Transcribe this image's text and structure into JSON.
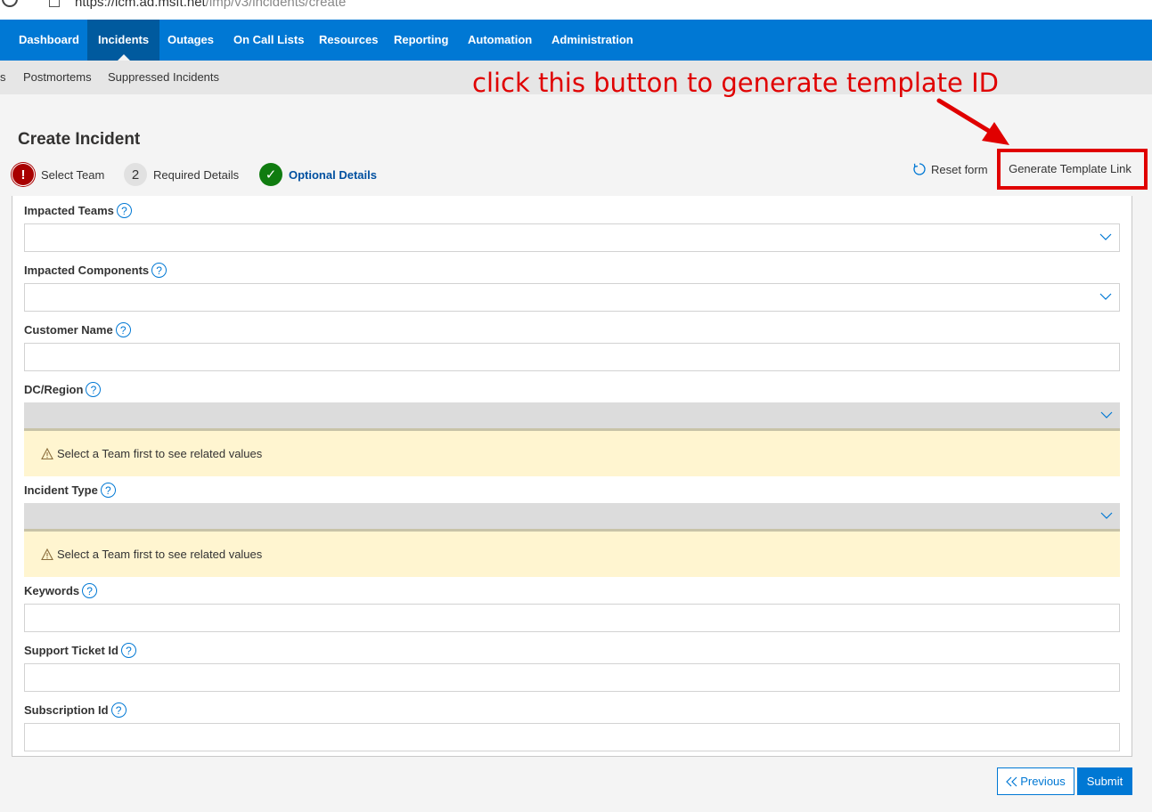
{
  "browser": {
    "url_host": "https://icm.ad.msft.net",
    "url_path": "/imp/v3/incidents/create"
  },
  "topnav": {
    "items": [
      {
        "label": "Dashboard"
      },
      {
        "label": "Incidents",
        "active": true
      },
      {
        "label": "Outages"
      },
      {
        "label": "On Call Lists"
      },
      {
        "label": "Resources"
      },
      {
        "label": "Reporting"
      },
      {
        "label": "Automation"
      },
      {
        "label": "Administration"
      }
    ]
  },
  "subnav": {
    "partial": "s",
    "items": [
      {
        "label": "Postmortems"
      },
      {
        "label": "Suppressed Incidents"
      }
    ]
  },
  "annotation": {
    "text": "click this button to generate template ID",
    "color": "#e00000"
  },
  "page": {
    "title": "Create Incident"
  },
  "steps": [
    {
      "marker": "!",
      "label": "Select Team",
      "state": "error"
    },
    {
      "marker": "2",
      "label": "Required Details",
      "state": "pending"
    },
    {
      "marker": "✓",
      "label": "Optional Details",
      "state": "current"
    }
  ],
  "actions": {
    "reset_label": "Reset form",
    "generate_label": "Generate Template Link"
  },
  "fields": {
    "impacted_teams": {
      "label": "Impacted Teams"
    },
    "impacted_components": {
      "label": "Impacted Components"
    },
    "customer_name": {
      "label": "Customer Name"
    },
    "dc_region": {
      "label": "DC/Region",
      "warning": "Select a Team first to see related values"
    },
    "incident_type": {
      "label": "Incident Type",
      "warning": "Select a Team first to see related values"
    },
    "keywords": {
      "label": "Keywords"
    },
    "support_ticket_id": {
      "label": "Support Ticket Id"
    },
    "subscription_id": {
      "label": "Subscription Id"
    }
  },
  "help_glyph": "?",
  "footer": {
    "previous_label": "Previous",
    "submit_label": "Submit"
  },
  "colors": {
    "brand": "#0078d4",
    "error": "#a80000",
    "success": "#107c10",
    "warning_bg": "#fff5d0"
  }
}
